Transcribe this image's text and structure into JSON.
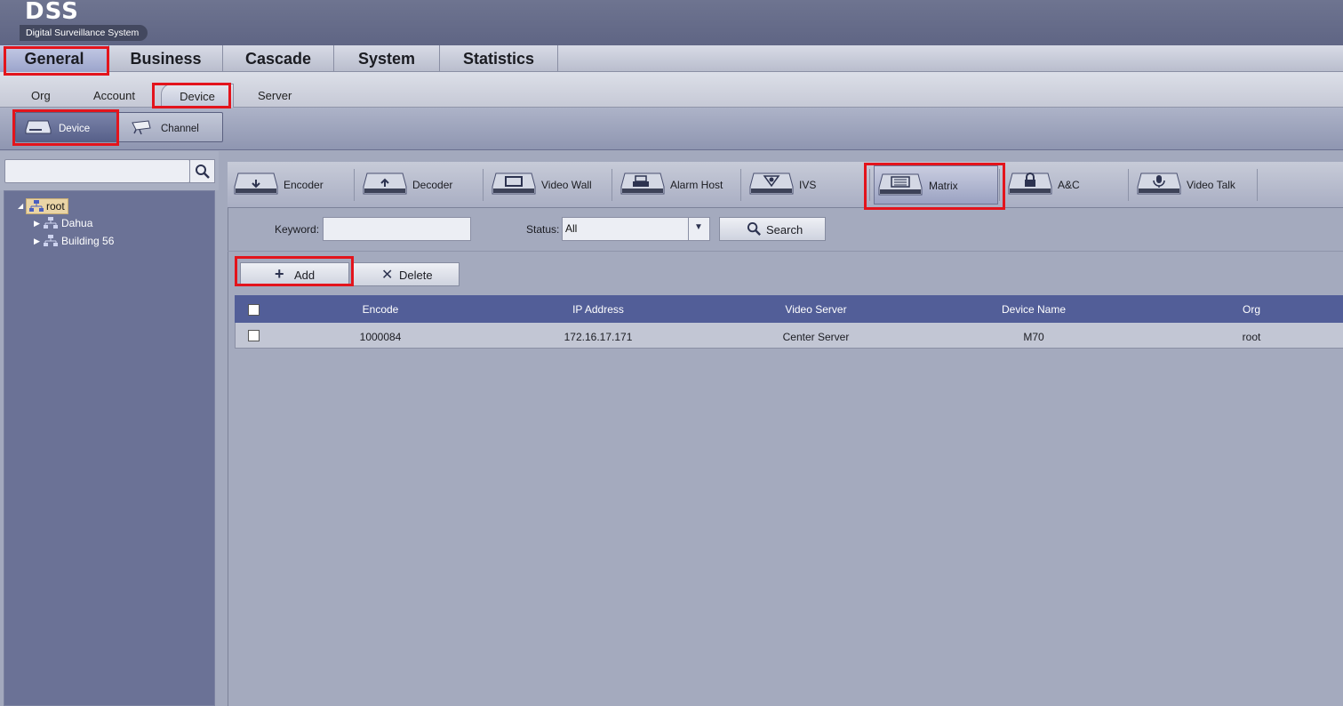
{
  "app": {
    "title": "DSS",
    "subtitle": "Digital Surveillance System"
  },
  "main_menu": [
    {
      "label": "General",
      "active": true
    },
    {
      "label": "Business",
      "active": false
    },
    {
      "label": "Cascade",
      "active": false
    },
    {
      "label": "System",
      "active": false
    },
    {
      "label": "Statistics",
      "active": false
    }
  ],
  "sub_menu": [
    {
      "label": "Org"
    },
    {
      "label": "Account"
    },
    {
      "label": "Device",
      "active": true
    },
    {
      "label": "Server"
    }
  ],
  "mode_buttons": [
    {
      "label": "Device",
      "icon": "device-icon",
      "active": true
    },
    {
      "label": "Channel",
      "icon": "camera-icon",
      "active": false
    }
  ],
  "tree": {
    "search_value": "",
    "search_icon": "search-icon",
    "nodes": [
      {
        "label": "root",
        "icon": "org-tree-icon"
      },
      {
        "label": "Dahua",
        "icon": "org-tree-icon"
      },
      {
        "label": "Building 56",
        "icon": "org-tree-icon"
      }
    ]
  },
  "device_types": [
    {
      "label": "Encoder",
      "icon": "encoder-icon"
    },
    {
      "label": "Decoder",
      "icon": "decoder-icon"
    },
    {
      "label": "Video Wall",
      "icon": "video-wall-icon"
    },
    {
      "label": "Alarm Host",
      "icon": "alarm-host-icon"
    },
    {
      "label": "IVS",
      "icon": "ivs-icon"
    },
    {
      "label": "Matrix",
      "icon": "matrix-icon",
      "active": true
    },
    {
      "label": "A&C",
      "icon": "lock-icon"
    },
    {
      "label": "Video Talk",
      "icon": "microphone-icon"
    }
  ],
  "filter": {
    "keyword_label": "Keyword:",
    "keyword_value": "",
    "status_label": "Status:",
    "status_value": "All",
    "search_label": "Search"
  },
  "actions": {
    "add_label": "Add",
    "delete_label": "Delete"
  },
  "table": {
    "columns": [
      "Encode",
      "IP Address",
      "Video Server",
      "Device Name",
      "Org"
    ],
    "rows": [
      [
        "1000084",
        "172.16.17.171",
        "Center Server",
        "M70",
        "root"
      ]
    ]
  },
  "colors": {
    "highlight": "#e3141c",
    "table_header": "#525e98",
    "tree_bg": "#6b7296"
  }
}
